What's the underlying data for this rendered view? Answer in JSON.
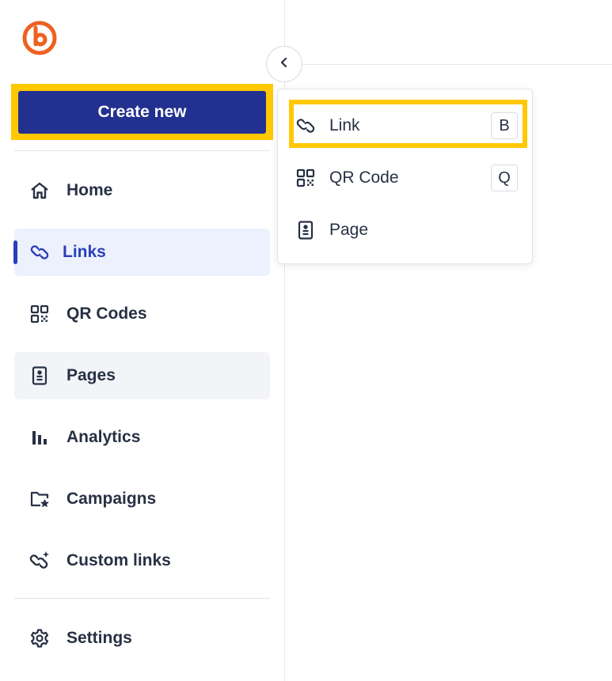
{
  "brand": {
    "logo_icon": "bitly-logo-icon",
    "logo_color": "#ee6123"
  },
  "sidebar": {
    "create_label": "Create new",
    "create_color": "#22308f",
    "items": [
      {
        "label": "Home",
        "icon": "home-icon"
      },
      {
        "label": "Links",
        "icon": "link-icon",
        "active": true
      },
      {
        "label": "QR Codes",
        "icon": "qr-code-icon"
      },
      {
        "label": "Pages",
        "icon": "page-icon",
        "hovered": true
      },
      {
        "label": "Analytics",
        "icon": "bar-chart-icon"
      },
      {
        "label": "Campaigns",
        "icon": "folder-star-icon"
      },
      {
        "label": "Custom links",
        "icon": "custom-link-icon"
      }
    ],
    "settings_label": "Settings"
  },
  "collapse_button": {
    "icon": "chevron-left-icon"
  },
  "dropdown": {
    "items": [
      {
        "label": "Link",
        "shortcut": "B",
        "icon": "link-icon"
      },
      {
        "label": "QR Code",
        "shortcut": "Q",
        "icon": "qr-code-icon"
      },
      {
        "label": "Page",
        "shortcut": "",
        "icon": "page-icon"
      }
    ]
  },
  "colors": {
    "highlight": "#ffc800",
    "accent": "#2a3fb9",
    "active_bg": "#edf1fe"
  }
}
